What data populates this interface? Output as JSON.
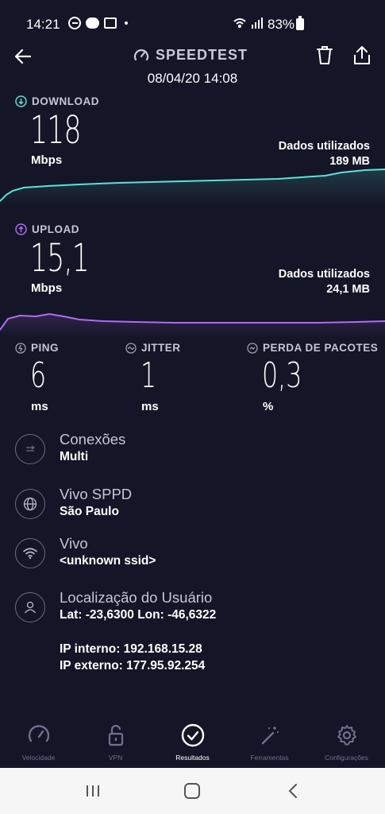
{
  "status_bar": {
    "time": "14:21",
    "battery": "83%"
  },
  "header": {
    "brand": "SPEEDTEST",
    "date": "08/04/20 14:08"
  },
  "download": {
    "label": "DOWNLOAD",
    "value": "118",
    "unit": "Mbps",
    "data_used_label": "Dados utilizados",
    "data_used_value": "189 MB",
    "color": "#5ce1d8"
  },
  "upload": {
    "label": "UPLOAD",
    "value": "15,1",
    "unit": "Mbps",
    "data_used_label": "Dados utilizados",
    "data_used_value": "24,1 MB",
    "color": "#b06bf2"
  },
  "ping": {
    "label": "PING",
    "value": "6",
    "unit": "ms"
  },
  "jitter": {
    "label": "JITTER",
    "value": "1",
    "unit": "ms"
  },
  "loss": {
    "label": "PERDA DE PACOTES",
    "value": "0,3",
    "unit": "%"
  },
  "info": {
    "connections": {
      "title": "Conexões",
      "value": "Multi",
      "icon": "connections-icon"
    },
    "server": {
      "title": "Vivo SPPD",
      "value": "São Paulo",
      "icon": "globe-icon"
    },
    "provider": {
      "title": "Vivo",
      "value": "<unknown ssid>",
      "icon": "wifi-icon"
    },
    "location": {
      "title": "Localização do Usuário",
      "value": "Lat: -23,6300 Lon: -46,6322",
      "icon": "user-icon"
    },
    "ip_internal": "IP interno: 192.168.15.28",
    "ip_external": "IP externo: 177.95.92.254"
  },
  "nav": {
    "items": [
      {
        "label": "Velocidade",
        "icon": "speedometer-icon",
        "active": false
      },
      {
        "label": "VPN",
        "icon": "lock-icon",
        "active": false
      },
      {
        "label": "Resultados",
        "icon": "check-circle-icon",
        "active": true
      },
      {
        "label": "Ferramentas",
        "icon": "magic-wand-icon",
        "active": false
      },
      {
        "label": "Configurações",
        "icon": "gear-icon",
        "active": false
      }
    ]
  }
}
